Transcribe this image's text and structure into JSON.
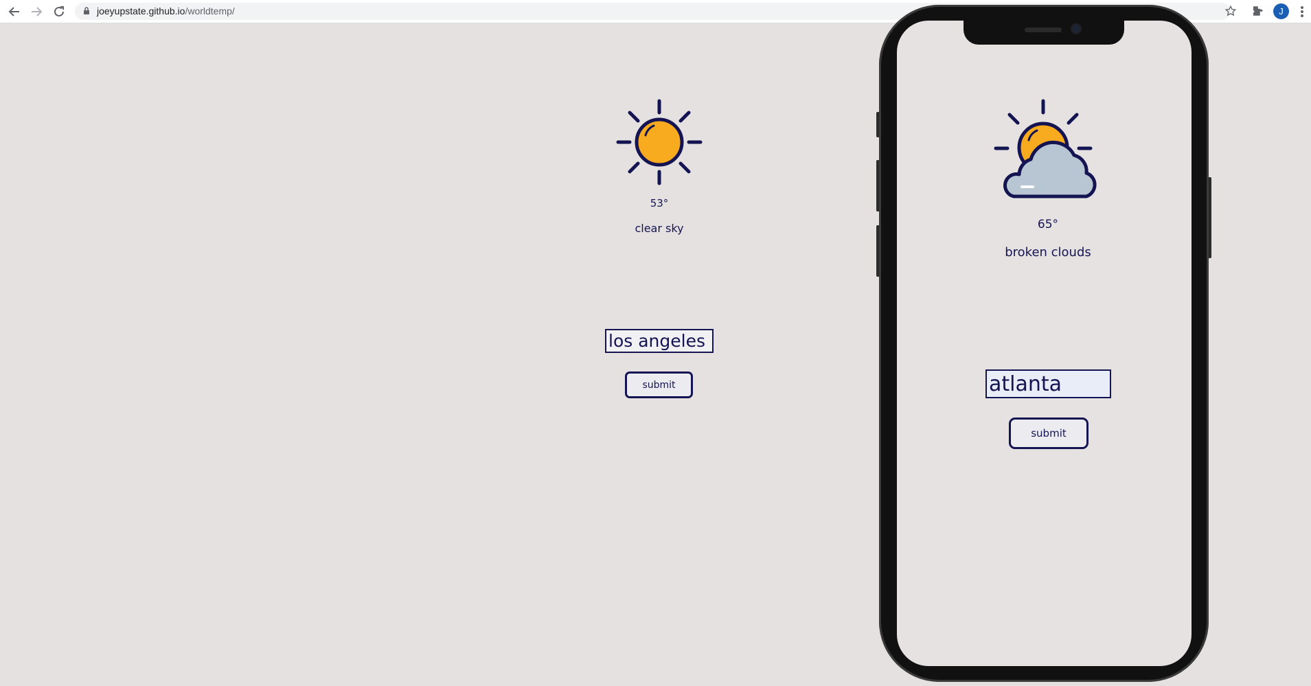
{
  "browser": {
    "url_host": "joeyupstate.github.io",
    "url_path": "/worldtemp/",
    "profile_initial": "J",
    "icons": [
      "back-icon",
      "forward-icon",
      "reload-icon",
      "lock-icon",
      "star-icon",
      "extensions-icon",
      "menu-icon"
    ]
  },
  "desktop_app": {
    "icon": "sun-icon",
    "temperature": "53°",
    "description": "clear sky",
    "city_input_value": "los angeles",
    "submit_label": "submit"
  },
  "phone_app": {
    "icon": "sun-behind-cloud-icon",
    "temperature": "65°",
    "description": "broken clouds",
    "city_input_value": "atlanta",
    "submit_label": "submit"
  },
  "colors": {
    "background": "#e5e1e1",
    "text": "#141452",
    "sun": "#f8ab1f",
    "cloud": "#b8c6d4"
  }
}
